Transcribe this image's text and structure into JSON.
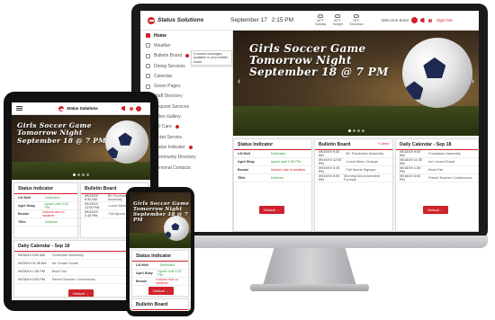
{
  "brand": {
    "name": "Status Solutions",
    "accent": "#d0222b"
  },
  "desktop": {
    "header": {
      "date": "September 17",
      "time": "2:15 PM",
      "weather": [
        {
          "temp": "82°F",
          "label": "Sunday"
        },
        {
          "temp": "63°F",
          "label": "Tonight"
        },
        {
          "temp": "76°F",
          "label": "Tomorrow"
        }
      ],
      "welcome": "Welcome Brian",
      "badge": "3",
      "signout": "Sign Out"
    },
    "sidebar": [
      {
        "label": "Home",
        "icon": "home-icon",
        "active": true
      },
      {
        "label": "Weather",
        "icon": "weather-icon"
      },
      {
        "label": "Bulletin Board",
        "icon": "bulletin-icon",
        "dot": true
      },
      {
        "label": "Dining Services",
        "icon": "dining-icon"
      },
      {
        "label": "Calendar",
        "icon": "calendar-icon"
      },
      {
        "label": "Green Pages",
        "icon": "pages-icon"
      },
      {
        "label": "Staff Directory",
        "icon": "staff-icon"
      },
      {
        "label": "Request Services",
        "icon": "request-icon"
      },
      {
        "label": "Video Gallery",
        "icon": "video-icon"
      },
      {
        "label": "Tell Care",
        "icon": "tellcare-icon",
        "dot": true
      },
      {
        "label": "Ticket Service",
        "icon": "ticket-icon"
      },
      {
        "label": "Status Indicator",
        "icon": "status-icon",
        "dot": true
      },
      {
        "label": "Community Directory",
        "icon": "community-icon"
      },
      {
        "label": "Personal Contacts",
        "icon": "contacts-icon"
      }
    ],
    "tooltip": "3 unread messages available in your bulletin board",
    "banner": {
      "line1": "Girls Soccer Game",
      "line2": "Tomorrow Night",
      "line3": "September 18 @ 7 PM"
    },
    "status": {
      "title": "Status Indicator",
      "rows": [
        {
          "k": "Lili Mell",
          "v": "Defended",
          "c": "green"
        },
        {
          "k": "April Shay",
          "v": "Upset until 3:30 PM",
          "c": "green"
        },
        {
          "k": "Bessie",
          "v": "Indoors due to weather",
          "c": "red"
        },
        {
          "k": "Tillie",
          "v": "Defense",
          "c": "green"
        }
      ],
      "button": "Default"
    },
    "bulletin": {
      "title": "Bulletin Board",
      "sub": "+ Latest",
      "rows": [
        {
          "d": "09/19/19 9:30 AM",
          "t": "BC Fundraiser Assembly"
        },
        {
          "d": "09/19/19 12:00 PM",
          "t": "Lunch Menu Change"
        },
        {
          "d": "09/19/19 3:15 PM",
          "t": "Fall Sports Signups"
        },
        {
          "d": "09/19/19 5:00 PM",
          "t": "Morning Announcement Formats"
        }
      ]
    },
    "calendar": {
      "title": "Daily Calendar - Sep 18",
      "rows": [
        {
          "d": "09/18/19 9:00 AM",
          "t": "Fundraiser Assembly"
        },
        {
          "d": "09/18/19 11:30 AM",
          "t": "Ice Cream Social"
        },
        {
          "d": "09/18/19 1:30 PM",
          "t": "Book Fair"
        },
        {
          "d": "09/18/19 3:00 PM",
          "t": "Parent Teacher Conferences"
        }
      ],
      "button": "Default"
    }
  }
}
